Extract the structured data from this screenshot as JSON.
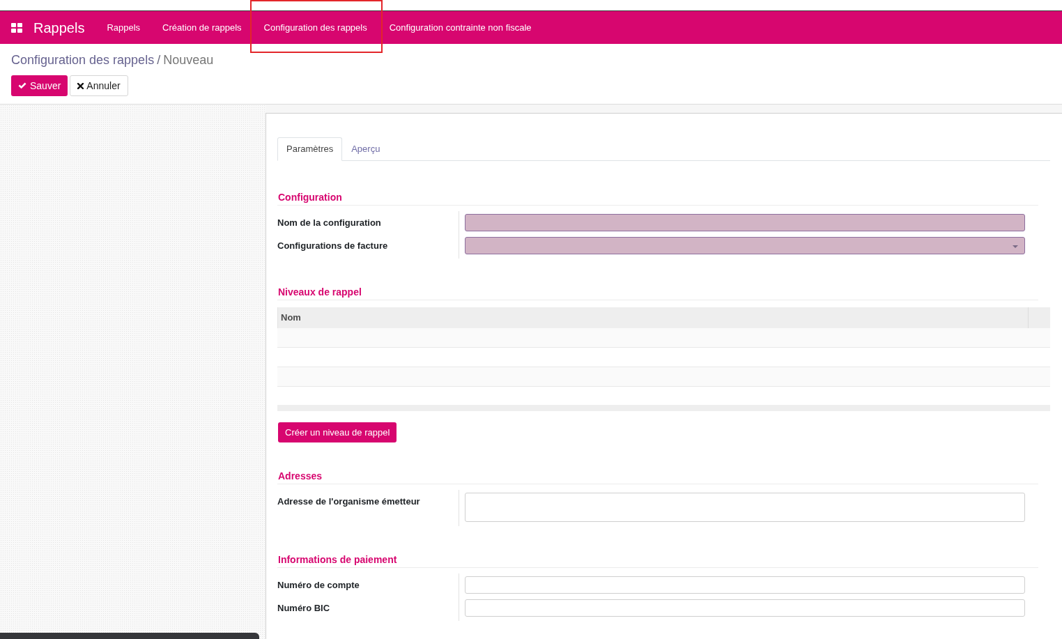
{
  "navbar": {
    "brand": "Rappels",
    "menu": [
      {
        "label": "Rappels",
        "highlighted": false
      },
      {
        "label": "Création de rappels",
        "highlighted": false
      },
      {
        "label": "Configuration des rappels",
        "highlighted": true
      },
      {
        "label": "Configuration contrainte non fiscale",
        "highlighted": false
      }
    ]
  },
  "breadcrumb": {
    "items": [
      {
        "label": "Configuration des rappels",
        "kind": "link"
      },
      {
        "label": "Nouveau",
        "kind": "current"
      }
    ],
    "separator": "/"
  },
  "actions": [
    {
      "label": "Sauver",
      "kind": "primary"
    },
    {
      "label": "Annuler",
      "kind": "secondary"
    }
  ],
  "tabs": [
    {
      "label": "Paramètres",
      "selected": true
    },
    {
      "label": "Aperçu",
      "selected": false
    }
  ],
  "sections": [
    {
      "title": "Configuration",
      "kind": "fields",
      "fields": [
        {
          "label": "Nom de la configuration",
          "kind": "text",
          "required": true
        },
        {
          "label": "Configurations de facture",
          "kind": "select",
          "required": true
        }
      ]
    },
    {
      "title": "Niveaux de rappel",
      "kind": "list",
      "columns": [
        {
          "label": "Nom"
        }
      ],
      "create_button": "Créer un niveau de rappel"
    },
    {
      "title": "Adresses",
      "kind": "fields",
      "fields": [
        {
          "label": "Adresse de l'organisme émetteur",
          "kind": "textarea",
          "required": false
        }
      ]
    },
    {
      "title": "Informations de paiement",
      "kind": "fields",
      "fields": [
        {
          "label": "Numéro de compte",
          "kind": "text",
          "required": false
        },
        {
          "label": "Numéro BIC",
          "kind": "text",
          "required": false
        }
      ]
    }
  ]
}
